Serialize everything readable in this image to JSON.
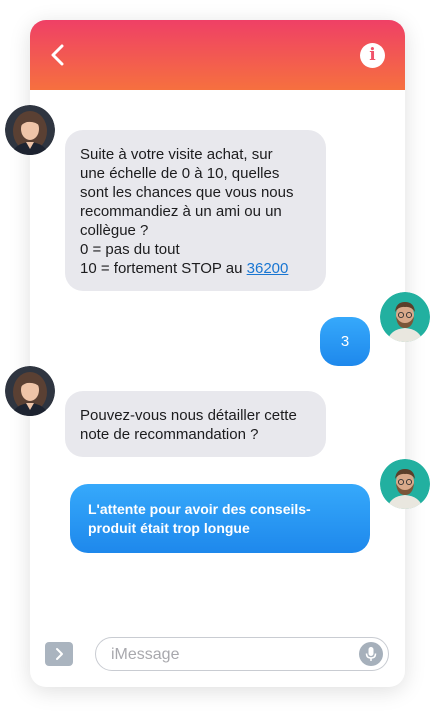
{
  "header": {
    "back_icon": "chevron-left-icon",
    "info_icon": "info-icon",
    "info_glyph": "i",
    "gradient_top": "#ef4066",
    "gradient_bottom": "#f6703f"
  },
  "messages": [
    {
      "direction": "incoming",
      "lines": [
        "Suite à votre visite achat, sur",
        "une échelle de 0 à 10, quelles",
        "sont les chances que vous nous",
        "recommandiez à un ami ou un",
        "collègue ?",
        "0 = pas du tout"
      ],
      "last_line_prefix": "10 = fortement STOP au ",
      "link_text": "36200"
    },
    {
      "direction": "outgoing",
      "text": "3"
    },
    {
      "direction": "incoming",
      "lines": [
        "Pouvez-vous nous détailler cette",
        "note de recommandation ?"
      ]
    },
    {
      "direction": "outgoing",
      "lines": [
        "L'attente pour avoir des conseils-",
        "produit était trop longue"
      ]
    }
  ],
  "composer": {
    "placeholder": "iMessage",
    "apps_icon": "chevron-right-icon",
    "mic_icon": "microphone-icon"
  },
  "colors": {
    "incoming_bubble": "#e8e8ed",
    "outgoing_bubble": "#2a97f3",
    "link": "#1976d2"
  }
}
